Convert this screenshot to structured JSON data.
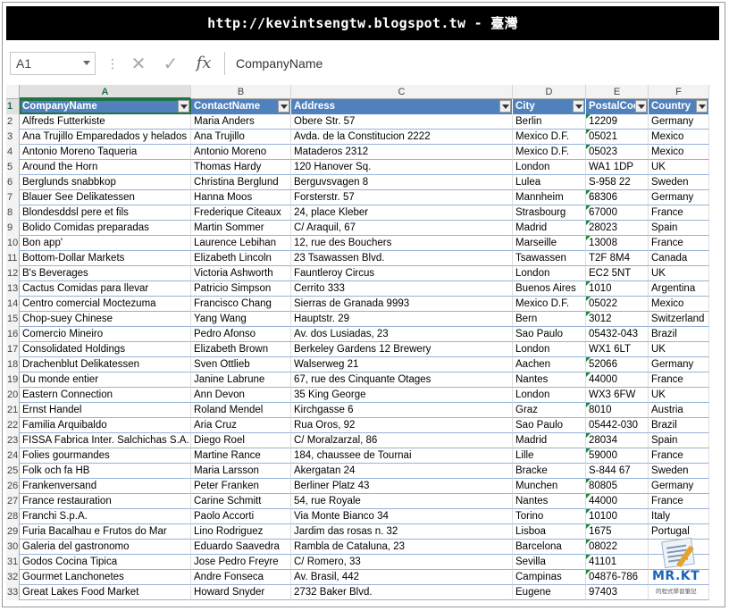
{
  "banner": {
    "text": "http://kevintsengtw.blogspot.tw - 臺灣"
  },
  "formula_bar": {
    "name_box": "A1",
    "separator_icon": "⋮",
    "cancel_icon": "✕",
    "enter_icon": "✓",
    "fx_label": "fx",
    "formula": "CompanyName"
  },
  "sheet": {
    "column_letters": [
      "A",
      "B",
      "C",
      "D",
      "E",
      "F"
    ],
    "headers": [
      "CompanyName",
      "ContactName",
      "Address",
      "City",
      "PostalCod",
      "Country"
    ],
    "header_row_number": "1",
    "rows": [
      {
        "n": "2",
        "c": [
          "Alfreds Futterkiste",
          "Maria Anders",
          "Obere Str. 57",
          "Berlin",
          "12209",
          "Germany"
        ],
        "t": true
      },
      {
        "n": "3",
        "c": [
          "Ana Trujillo Emparedados y helados",
          "Ana Trujillo",
          "Avda. de la Constitucion 2222",
          "Mexico D.F.",
          "05021",
          "Mexico"
        ],
        "t": true
      },
      {
        "n": "4",
        "c": [
          "Antonio Moreno Taqueria",
          "Antonio Moreno",
          "Mataderos  2312",
          "Mexico D.F.",
          "05023",
          "Mexico"
        ],
        "t": true
      },
      {
        "n": "5",
        "c": [
          "Around the Horn",
          "Thomas Hardy",
          "120 Hanover Sq.",
          "London",
          "WA1 1DP",
          "UK"
        ],
        "t": false
      },
      {
        "n": "6",
        "c": [
          "Berglunds snabbkop",
          "Christina Berglund",
          "Berguvsvagen  8",
          "Lulea",
          "S-958 22",
          "Sweden"
        ],
        "t": false
      },
      {
        "n": "7",
        "c": [
          "Blauer See Delikatessen",
          "Hanna Moos",
          "Forsterstr. 57",
          "Mannheim",
          "68306",
          "Germany"
        ],
        "t": true
      },
      {
        "n": "8",
        "c": [
          "Blondesddsl pere et fils",
          "Frederique Citeaux",
          "24, place Kleber",
          "Strasbourg",
          "67000",
          "France"
        ],
        "t": true
      },
      {
        "n": "9",
        "c": [
          "Bolido Comidas preparadas",
          "Martin Sommer",
          "C/ Araquil, 67",
          "Madrid",
          "28023",
          "Spain"
        ],
        "t": true
      },
      {
        "n": "10",
        "c": [
          "Bon app'",
          "Laurence Lebihan",
          "12, rue des Bouchers",
          "Marseille",
          "13008",
          "France"
        ],
        "t": true
      },
      {
        "n": "11",
        "c": [
          "Bottom-Dollar Markets",
          "Elizabeth Lincoln",
          "23 Tsawassen Blvd.",
          "Tsawassen",
          "T2F 8M4",
          "Canada"
        ],
        "t": false
      },
      {
        "n": "12",
        "c": [
          "B's Beverages",
          "Victoria Ashworth",
          "Fauntleroy Circus",
          "London",
          "EC2 5NT",
          "UK"
        ],
        "t": false
      },
      {
        "n": "13",
        "c": [
          "Cactus Comidas para llevar",
          "Patricio Simpson",
          "Cerrito 333",
          "Buenos Aires",
          "1010",
          "Argentina"
        ],
        "t": true
      },
      {
        "n": "14",
        "c": [
          "Centro comercial Moctezuma",
          "Francisco Chang",
          "Sierras de Granada 9993",
          "Mexico D.F.",
          "05022",
          "Mexico"
        ],
        "t": true
      },
      {
        "n": "15",
        "c": [
          "Chop-suey Chinese",
          "Yang Wang",
          "Hauptstr. 29",
          "Bern",
          "3012",
          "Switzerland"
        ],
        "t": true
      },
      {
        "n": "16",
        "c": [
          "Comercio Mineiro",
          "Pedro Afonso",
          "Av. dos Lusiadas, 23",
          "Sao Paulo",
          "05432-043",
          "Brazil"
        ],
        "t": false
      },
      {
        "n": "17",
        "c": [
          "Consolidated Holdings",
          "Elizabeth Brown",
          "Berkeley Gardens 12  Brewery",
          "London",
          "WX1 6LT",
          "UK"
        ],
        "t": false
      },
      {
        "n": "18",
        "c": [
          "Drachenblut Delikatessen",
          "Sven Ottlieb",
          "Walserweg 21",
          "Aachen",
          "52066",
          "Germany"
        ],
        "t": true
      },
      {
        "n": "19",
        "c": [
          "Du monde entier",
          "Janine Labrune",
          "67, rue des Cinquante Otages",
          "Nantes",
          "44000",
          "France"
        ],
        "t": true
      },
      {
        "n": "20",
        "c": [
          "Eastern Connection",
          "Ann Devon",
          "35 King George",
          "London",
          "WX3 6FW",
          "UK"
        ],
        "t": false
      },
      {
        "n": "21",
        "c": [
          "Ernst Handel",
          "Roland Mendel",
          "Kirchgasse 6",
          "Graz",
          "8010",
          "Austria"
        ],
        "t": true
      },
      {
        "n": "22",
        "c": [
          "Familia Arquibaldo",
          "Aria Cruz",
          "Rua Oros, 92",
          "Sao Paulo",
          "05442-030",
          "Brazil"
        ],
        "t": false
      },
      {
        "n": "23",
        "c": [
          "FISSA Fabrica Inter. Salchichas S.A.",
          "Diego Roel",
          "C/ Moralzarzal, 86",
          "Madrid",
          "28034",
          "Spain"
        ],
        "t": true
      },
      {
        "n": "24",
        "c": [
          "Folies gourmandes",
          "Martine Rance",
          "184, chaussee de Tournai",
          "Lille",
          "59000",
          "France"
        ],
        "t": true
      },
      {
        "n": "25",
        "c": [
          "Folk och fa HB",
          "Maria Larsson",
          "Akergatan 24",
          "Bracke",
          "S-844 67",
          "Sweden"
        ],
        "t": false
      },
      {
        "n": "26",
        "c": [
          "Frankenversand",
          "Peter Franken",
          "Berliner Platz 43",
          "Munchen",
          "80805",
          "Germany"
        ],
        "t": true
      },
      {
        "n": "27",
        "c": [
          "France restauration",
          "Carine Schmitt",
          "54, rue Royale",
          "Nantes",
          "44000",
          "France"
        ],
        "t": true
      },
      {
        "n": "28",
        "c": [
          "Franchi S.p.A.",
          "Paolo Accorti",
          "Via Monte Bianco 34",
          "Torino",
          "10100",
          "Italy"
        ],
        "t": true
      },
      {
        "n": "29",
        "c": [
          "Furia Bacalhau e Frutos do Mar",
          "Lino Rodriguez",
          "Jardim das rosas n. 32",
          "Lisboa",
          "1675",
          "Portugal"
        ],
        "t": true
      },
      {
        "n": "30",
        "c": [
          "Galeria del gastronomo",
          "Eduardo Saavedra",
          "Rambla de Cataluna, 23",
          "Barcelona",
          "08022",
          ""
        ],
        "t": true
      },
      {
        "n": "31",
        "c": [
          "Godos Cocina Tipica",
          "Jose Pedro Freyre",
          "C/ Romero, 33",
          "Sevilla",
          "41101",
          ""
        ],
        "t": true
      },
      {
        "n": "32",
        "c": [
          "Gourmet Lanchonetes",
          "Andre Fonseca",
          "Av. Brasil, 442",
          "Campinas",
          "04876-786",
          ""
        ],
        "t": true
      },
      {
        "n": "33",
        "c": [
          "Great Lakes Food Market",
          "Howard Snyder",
          "2732 Baker Blvd.",
          "Eugene",
          "97403",
          ""
        ],
        "t": false
      }
    ]
  },
  "logo": {
    "title": "MR.KT",
    "subtitle": "的程式學習筆記"
  },
  "colors": {
    "header_fill": "#4f81bd",
    "selection": "#217346",
    "row_line": "#95b3d7",
    "error_triangle": "#1e8a3a"
  }
}
